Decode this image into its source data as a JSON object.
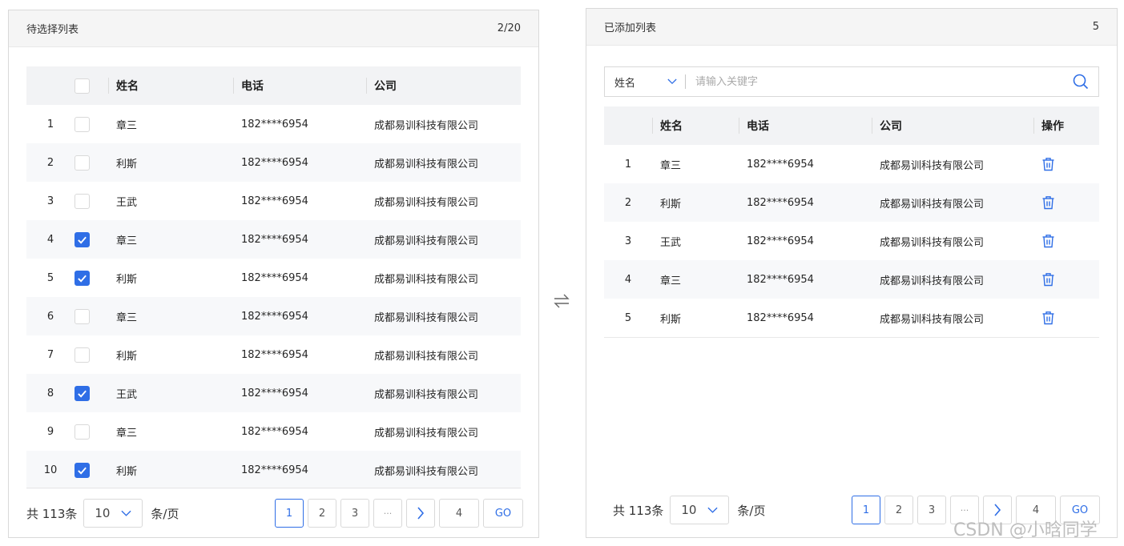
{
  "left": {
    "title": "待选择列表",
    "count": "2/20",
    "headers": {
      "name": "姓名",
      "phone": "电话",
      "company": "公司"
    },
    "rows": [
      {
        "idx": "1",
        "checked": false,
        "name": "章三",
        "phone": "182****6954",
        "company": "成都易训科技有限公司"
      },
      {
        "idx": "2",
        "checked": false,
        "name": "利斯",
        "phone": "182****6954",
        "company": "成都易训科技有限公司"
      },
      {
        "idx": "3",
        "checked": false,
        "name": "王武",
        "phone": "182****6954",
        "company": "成都易训科技有限公司"
      },
      {
        "idx": "4",
        "checked": true,
        "name": "章三",
        "phone": "182****6954",
        "company": "成都易训科技有限公司"
      },
      {
        "idx": "5",
        "checked": true,
        "name": "利斯",
        "phone": "182****6954",
        "company": "成都易训科技有限公司"
      },
      {
        "idx": "6",
        "checked": false,
        "name": "章三",
        "phone": "182****6954",
        "company": "成都易训科技有限公司"
      },
      {
        "idx": "7",
        "checked": false,
        "name": "利斯",
        "phone": "182****6954",
        "company": "成都易训科技有限公司"
      },
      {
        "idx": "8",
        "checked": true,
        "name": "王武",
        "phone": "182****6954",
        "company": "成都易训科技有限公司"
      },
      {
        "idx": "9",
        "checked": false,
        "name": "章三",
        "phone": "182****6954",
        "company": "成都易训科技有限公司"
      },
      {
        "idx": "10",
        "checked": true,
        "name": "利斯",
        "phone": "182****6954",
        "company": "成都易训科技有限公司"
      }
    ],
    "pager": {
      "total": "共 113条",
      "page_size": "10",
      "per_page": "条/页",
      "pages": [
        "1",
        "2",
        "3",
        "···"
      ],
      "last": "4",
      "go": "GO",
      "active": "1"
    }
  },
  "right": {
    "title": "已添加列表",
    "count": "5",
    "search": {
      "field": "姓名",
      "placeholder": "请输入关键字"
    },
    "headers": {
      "name": "姓名",
      "phone": "电话",
      "company": "公司",
      "action": "操作"
    },
    "rows": [
      {
        "idx": "1",
        "name": "章三",
        "phone": "182****6954",
        "company": "成都易训科技有限公司"
      },
      {
        "idx": "2",
        "name": "利斯",
        "phone": "182****6954",
        "company": "成都易训科技有限公司"
      },
      {
        "idx": "3",
        "name": "王武",
        "phone": "182****6954",
        "company": "成都易训科技有限公司"
      },
      {
        "idx": "4",
        "name": "章三",
        "phone": "182****6954",
        "company": "成都易训科技有限公司"
      },
      {
        "idx": "5",
        "name": "利斯",
        "phone": "182****6954",
        "company": "成都易训科技有限公司"
      }
    ],
    "pager": {
      "total": "共 113条",
      "page_size": "10",
      "per_page": "条/页",
      "pages": [
        "1",
        "2",
        "3",
        "···"
      ],
      "last": "4",
      "go": "GO",
      "active": "1"
    }
  },
  "colors": {
    "accent": "#2f6ee6",
    "header_bg": "#f5f5f5",
    "row_alt": "#f7f8fa"
  },
  "watermark": "CSDN @小晗同学"
}
